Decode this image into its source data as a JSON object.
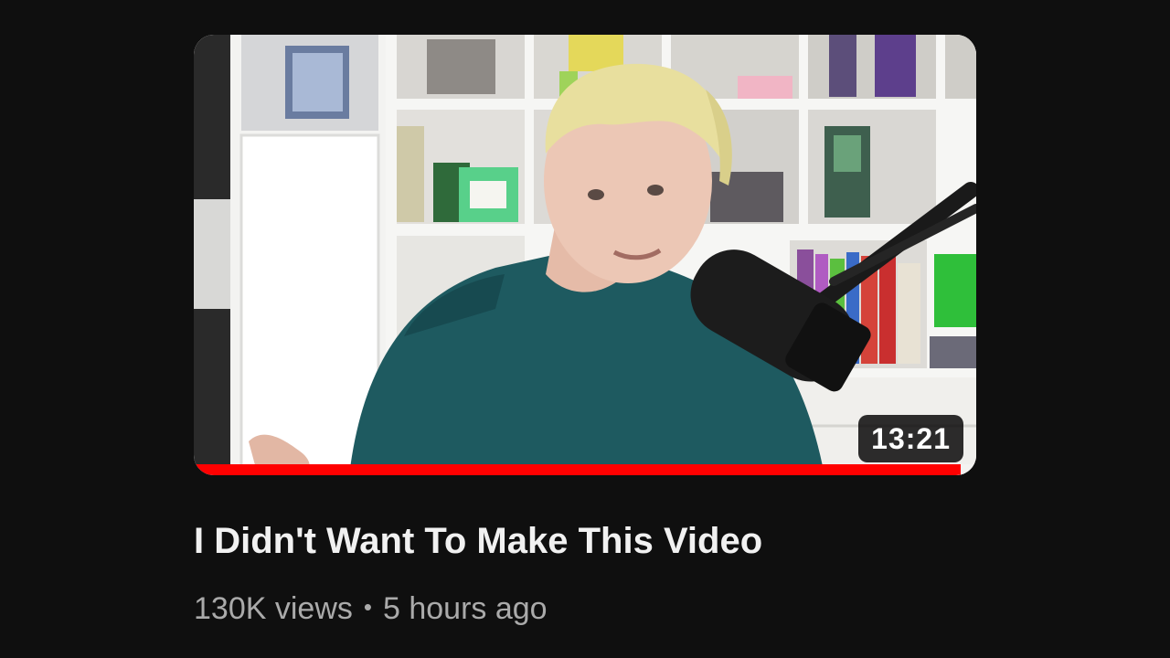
{
  "video": {
    "duration": "13:21",
    "title": "I Didn't Want To Make This Video",
    "views": "130K views",
    "separator": "•",
    "uploaded": "5 hours ago",
    "watch_progress": 0.98
  },
  "colors": {
    "background": "#0f0f0f",
    "progress": "#ff0000",
    "title": "#f1f1f1",
    "meta": "#aaaaaa"
  },
  "icons": {
    "thumbnail_scene": "person-with-microphone-in-front-of-shelves"
  }
}
